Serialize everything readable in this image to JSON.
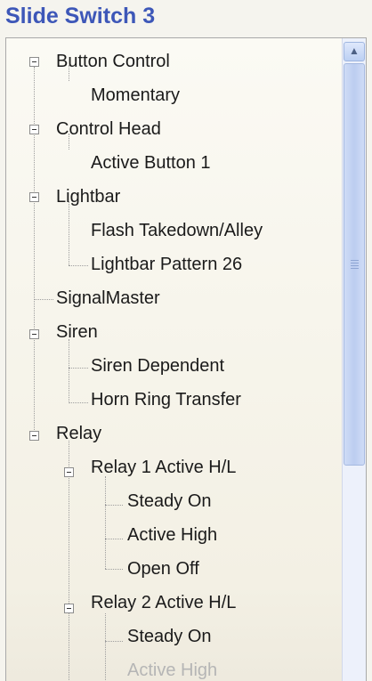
{
  "window": {
    "title": "Slide Switch 3"
  },
  "tree": {
    "nodes": [
      {
        "label": "Button Control"
      },
      {
        "label": "Momentary"
      },
      {
        "label": "Control Head"
      },
      {
        "label": "Active Button 1"
      },
      {
        "label": "Lightbar"
      },
      {
        "label": "Flash Takedown/Alley"
      },
      {
        "label": "Lightbar Pattern 26"
      },
      {
        "label": "SignalMaster"
      },
      {
        "label": "Siren"
      },
      {
        "label": "Siren Dependent"
      },
      {
        "label": "Horn Ring Transfer"
      },
      {
        "label": "Relay"
      },
      {
        "label": "Relay 1 Active H/L"
      },
      {
        "label": "Steady On"
      },
      {
        "label": "Active High"
      },
      {
        "label": "Open Off"
      },
      {
        "label": "Relay 2 Active H/L"
      },
      {
        "label": "Steady On"
      },
      {
        "label": "Active High"
      }
    ]
  },
  "icons": {
    "toggle": "minus-box-icon",
    "scroll_up": "chevron-up-icon",
    "grip": "scroll-grip-icon"
  },
  "colors": {
    "title": "#3d57b8",
    "scrollbar_thumb": "#bccdf0",
    "disabled_text": "#b5b5b5"
  }
}
